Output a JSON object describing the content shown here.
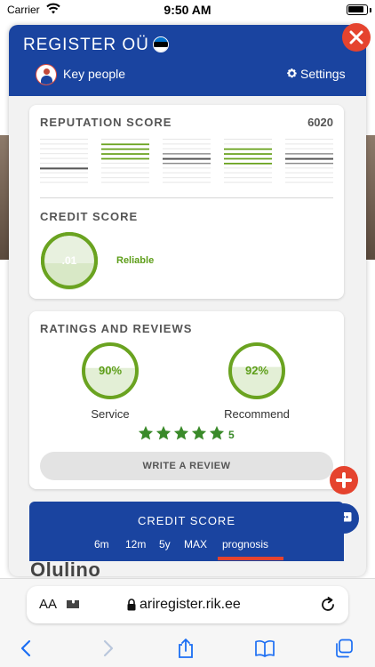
{
  "status_bar": {
    "carrier": "Carrier",
    "time": "9:50 AM"
  },
  "background": {
    "peek_text": "Olulino"
  },
  "header": {
    "company_name": "REGISTER OÜ",
    "key_people_label": "Key people",
    "settings_label": "Settings"
  },
  "reputation": {
    "title": "REPUTATION SCORE",
    "value": "6020",
    "bar_groups": [
      {
        "tone": "gray",
        "highlight_index": 4
      },
      {
        "tone": "green",
        "highlight_index": 1
      },
      {
        "tone": "gray",
        "highlight_index": 2
      },
      {
        "tone": "green",
        "highlight_index": 2
      },
      {
        "tone": "gray",
        "highlight_index": 2
      }
    ]
  },
  "credit_score": {
    "title": "CREDIT SCORE",
    "gauge_value": ".01",
    "status": "Reliable"
  },
  "ratings": {
    "title": "RATINGS AND REVIEWS",
    "service": {
      "value": "90%",
      "fraction": 0.9,
      "caption": "Service"
    },
    "recommend": {
      "value": "92%",
      "fraction": 0.92,
      "caption": "Recommend"
    },
    "stars": 5,
    "stars_count": "5",
    "write_review_label": "WRITE A REVIEW"
  },
  "credit_panel": {
    "title": "CREDIT SCORE",
    "ranges": [
      "6m",
      "12m",
      "5y",
      "MAX",
      "prognosis"
    ],
    "selected": "prognosis"
  },
  "browser": {
    "aa_label": "AA",
    "url": "ariregister.rik.ee"
  },
  "colors": {
    "brand_blue": "#1a44a0",
    "accent_red": "#e5432e",
    "green": "#5e9e1a",
    "star_green": "#3a8a2a"
  }
}
